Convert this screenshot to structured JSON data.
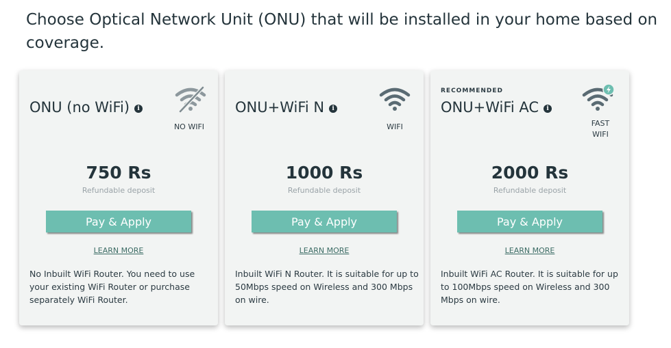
{
  "heading": "Choose Optical Network Unit (ONU) that will be installed in your home based on coverage.",
  "colors": {
    "accent": "#6dbeb0",
    "icon": "#5a6b73",
    "badge": "#6dbeb0"
  },
  "cards": [
    {
      "recommended": "",
      "title": "ONU (no WiFi)",
      "icon": "wifi-off-icon",
      "feature_label": "NO WIFI",
      "price": "750 Rs",
      "deposit": "Refundable deposit",
      "button": "Pay & Apply",
      "learn_more": "LEARN MORE",
      "description": "No Inbuilt WiFi Router. You need to use your existing WiFi Router or purchase separately WiFi Router."
    },
    {
      "recommended": "",
      "title": "ONU+WiFi N",
      "icon": "wifi-icon",
      "feature_label": "WIFI",
      "price": "1000 Rs",
      "deposit": "Refundable deposit",
      "button": "Pay & Apply",
      "learn_more": "LEARN MORE",
      "description": "Inbuilt WiFi N Router. It is suitable for up to 50Mbps speed on Wireless and 300 Mbps on wire."
    },
    {
      "recommended": "RECOMMENDED",
      "title": "ONU+WiFi AC",
      "icon": "fast-wifi-icon",
      "feature_label_line1": "FAST",
      "feature_label_line2": "WIFI",
      "price": "2000 Rs",
      "deposit": "Refundable deposit",
      "button": "Pay & Apply",
      "learn_more": "LEARN MORE",
      "description": "Inbuilt WiFi AC Router. It is suitable for up to 100Mbps speed on Wireless and 300 Mbps on wire."
    }
  ]
}
